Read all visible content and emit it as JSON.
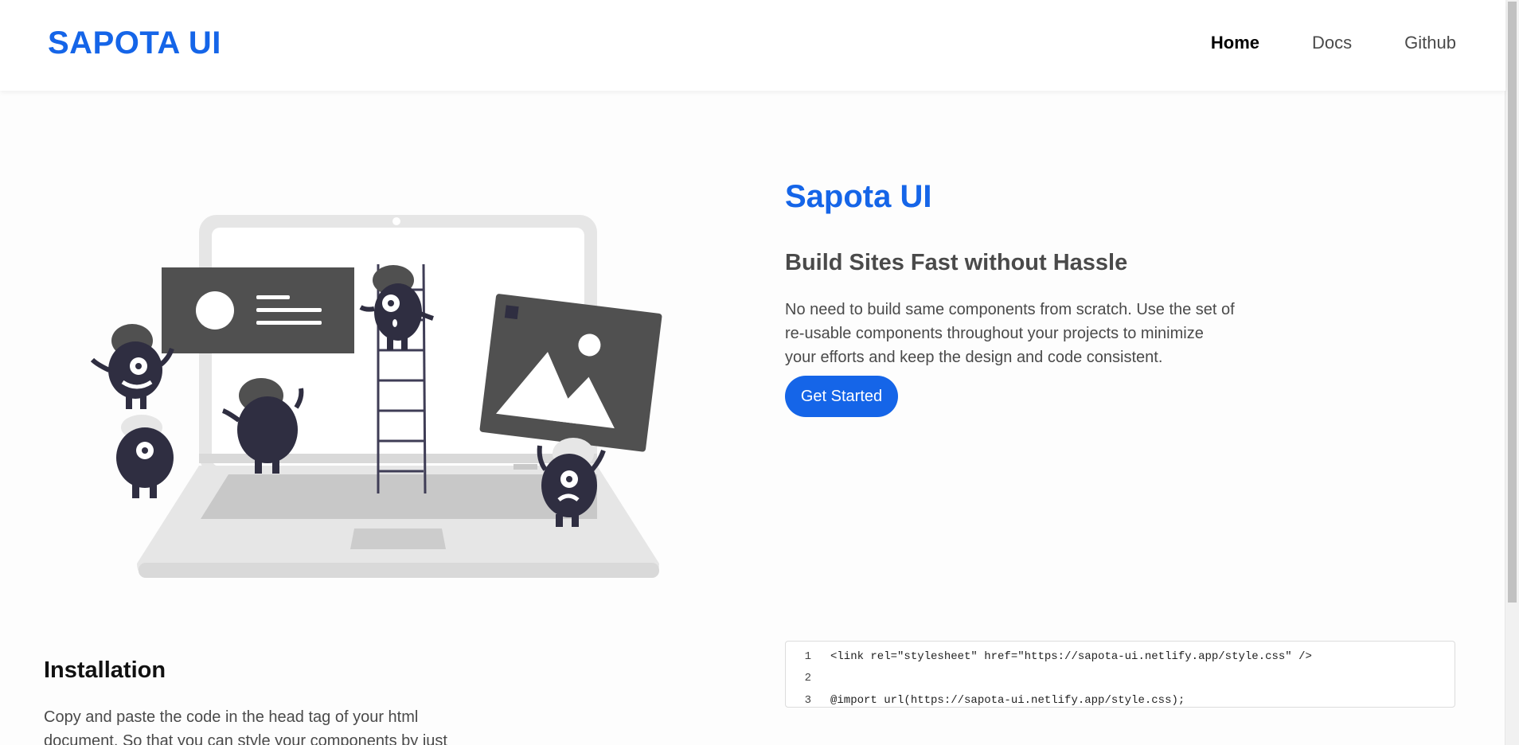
{
  "header": {
    "brand": "SAPOTA UI",
    "nav": [
      {
        "label": "Home",
        "active": true
      },
      {
        "label": "Docs",
        "active": false
      },
      {
        "label": "Github",
        "active": false
      }
    ]
  },
  "hero": {
    "title": "Sapota UI",
    "subtitle": "Build Sites Fast without Hassle",
    "description": "No need to build same components from scratch. Use the set of re-usable components throughout your projects to minimize your efforts and keep the design and code consistent.",
    "cta_label": "Get Started"
  },
  "installation": {
    "title": "Installation",
    "description": "Copy and paste the code in the head tag of your html document. So that you can style your components by just",
    "code_lines": [
      {
        "number": "1",
        "code": "<link rel=\"stylesheet\" href=\"https://sapota-ui.netlify.app/style.css\" />"
      },
      {
        "number": "2",
        "code": ""
      },
      {
        "number": "3",
        "code": "@import url(https://sapota-ui.netlify.app/style.css);"
      }
    ]
  },
  "colors": {
    "brand": "#1565e8",
    "text_dark": "#4a4a4a",
    "illustration_dark": "#2f2e41",
    "illustration_panel": "#505050",
    "illustration_light": "#e6e6e6"
  }
}
